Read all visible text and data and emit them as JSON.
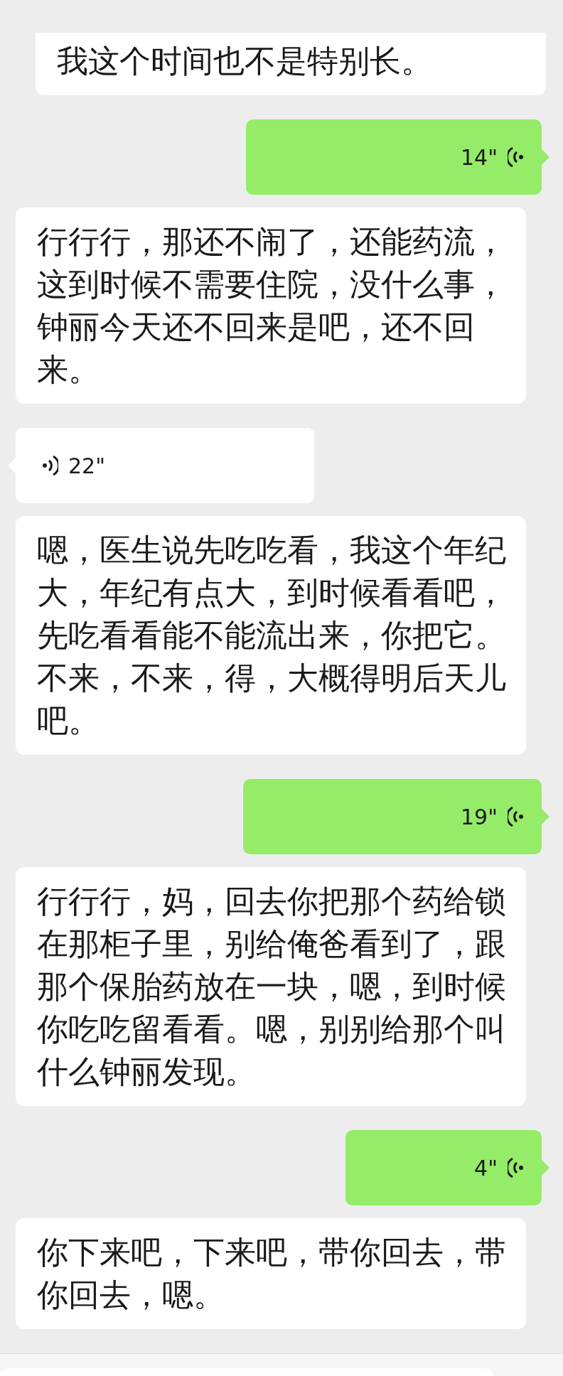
{
  "messages": [
    {
      "kind": "transcript",
      "text": "我这个时间也不是特别长。"
    },
    {
      "kind": "voice",
      "sent": true,
      "duration": "14\""
    },
    {
      "kind": "transcript",
      "text": "行行行，那还不闹了，还能药流，这到时候不需要住院，没什么事，钟丽今天还不回来是吧，还不回来。"
    },
    {
      "kind": "voice",
      "sent": false,
      "duration": "22\""
    },
    {
      "kind": "transcript",
      "text": "嗯，医生说先吃吃看，我这个年纪大，年纪有点大，到时候看看吧，先吃看看能不能流出来，你把它。不来，不来，得，大概得明后天儿吧。"
    },
    {
      "kind": "voice",
      "sent": true,
      "duration": "19\""
    },
    {
      "kind": "transcript",
      "text": "行行行，妈，回去你把那个药给锁在那柜子里，别给俺爸看到了，跟那个保胎药放在一块，嗯，到时候你吃吃留看看。嗯，别别给那个叫什么钟丽发现。"
    },
    {
      "kind": "voice",
      "sent": true,
      "duration": "4\""
    },
    {
      "kind": "transcript",
      "text": "你下来吧，下来吧，带你回去，带你回去，嗯。"
    }
  ]
}
